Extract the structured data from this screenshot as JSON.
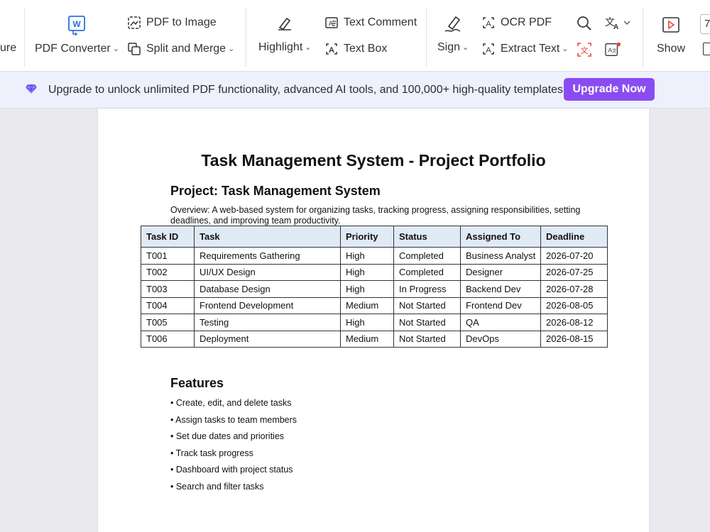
{
  "toolbar": {
    "partial_left_label": "ure",
    "pdf_converter": "PDF Converter",
    "pdf_to_image": "PDF to Image",
    "split_and_merge": "Split and Merge",
    "highlight": "Highlight",
    "text_comment": "Text Comment",
    "text_box": "Text Box",
    "sign": "Sign",
    "ocr_pdf": "OCR PDF",
    "extract_text": "Extract Text",
    "show": "Show",
    "partial_right_label": "7"
  },
  "banner": {
    "message": "Upgrade to unlock unlimited PDF functionality, advanced AI tools, and 100,000+ high-quality templates.",
    "button": "Upgrade Now"
  },
  "document": {
    "title": "Task Management System - Project Portfolio",
    "project_heading": "Project: Task Management System",
    "overview": "Overview: A web-based system for organizing tasks, tracking progress, assigning responsibilities, setting deadlines, and improving team productivity.",
    "table": {
      "headers": [
        "Task ID",
        "Task",
        "Priority",
        "Status",
        "Assigned To",
        "Deadline"
      ],
      "rows": [
        [
          "T001",
          "Requirements Gathering",
          "High",
          "Completed",
          "Business Analyst",
          "2026-07-20"
        ],
        [
          "T002",
          "UI/UX Design",
          "High",
          "Completed",
          "Designer",
          "2026-07-25"
        ],
        [
          "T003",
          "Database Design",
          "High",
          "In Progress",
          "Backend Dev",
          "2026-07-28"
        ],
        [
          "T004",
          "Frontend Development",
          "Medium",
          "Not Started",
          "Frontend Dev",
          "2026-08-05"
        ],
        [
          "T005",
          "Testing",
          "High",
          "Not Started",
          "QA",
          "2026-08-12"
        ],
        [
          "T006",
          "Deployment",
          "Medium",
          "Not Started",
          "DevOps",
          "2026-08-15"
        ]
      ]
    },
    "features_heading": "Features",
    "features": [
      "• Create, edit, and delete tasks",
      "• Assign tasks to team members",
      "• Set due dates and priorities",
      "• Track task progress",
      "• Dashboard with project status",
      "• Search and filter tasks"
    ]
  },
  "colors": {
    "accent": "#8a4cf1",
    "banner_bg": "#eef0fb",
    "table_header_bg": "#dfeaf5",
    "icon_blue": "#2a6fdb",
    "icon_red": "#e5433b"
  },
  "icons": [
    "word-convert-icon",
    "pdf-to-image-icon",
    "split-merge-icon",
    "highlight-pen-icon",
    "text-comment-icon",
    "text-box-icon",
    "sign-pen-icon",
    "ocr-icon",
    "extract-text-icon",
    "search-icon",
    "translate-icon",
    "scan-text-icon",
    "ai-text-icon",
    "show-play-icon",
    "gem-icon"
  ]
}
